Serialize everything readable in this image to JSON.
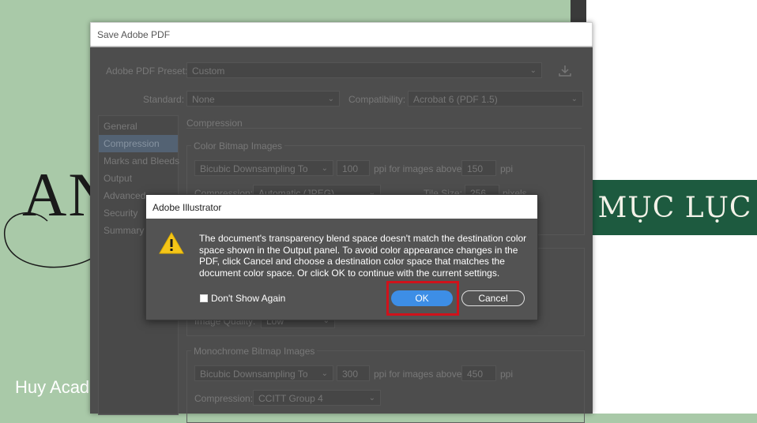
{
  "background": {
    "title_text": "AN",
    "band_text": "MỤC LỤC",
    "brand": "Huy Academy"
  },
  "pdf_dialog": {
    "title": "Save Adobe PDF",
    "preset_label": "Adobe PDF Preset:",
    "preset_value": "Custom",
    "standard_label": "Standard:",
    "standard_value": "None",
    "compat_label": "Compatibility:",
    "compat_value": "Acrobat 6 (PDF 1.5)",
    "sidebar": [
      {
        "label": "General"
      },
      {
        "label": "Compression"
      },
      {
        "label": "Marks and Bleeds"
      },
      {
        "label": "Output"
      },
      {
        "label": "Advanced"
      },
      {
        "label": "Security"
      },
      {
        "label": "Summary"
      }
    ],
    "section_title": "Compression",
    "color_group": {
      "title": "Color Bitmap Images",
      "sampling": "Bicubic Downsampling To",
      "ppi_value": "100",
      "ppi_label": "ppi for images above",
      "above_value": "150",
      "above_unit": "ppi",
      "compression_label": "Compression:",
      "compression_value": "Automatic (JPEG)",
      "tile_label": "Tile Size:",
      "tile_value": "256",
      "tile_unit": "pixels"
    },
    "gray_group": {
      "quality_label": "Image Quality:",
      "quality_value": "Low"
    },
    "mono_group": {
      "title": "Monochrome Bitmap Images",
      "sampling": "Bicubic Downsampling To",
      "ppi_value": "300",
      "ppi_label": "ppi for images above",
      "above_value": "450",
      "above_unit": "ppi",
      "compression_label": "Compression:",
      "compression_value": "CCITT Group 4"
    }
  },
  "alert": {
    "title": "Adobe Illustrator",
    "message": "The document's transparency blend space doesn't match the destination color space shown in the Output panel. To avoid color appearance changes in the PDF, click Cancel and choose a destination color space that matches the document color space. Or click OK to continue with the current settings.",
    "checkbox_label": "Don't Show Again",
    "ok_label": "OK",
    "cancel_label": "Cancel",
    "highlight_color": "#d0121b",
    "ok_color": "#3d8ee6"
  }
}
